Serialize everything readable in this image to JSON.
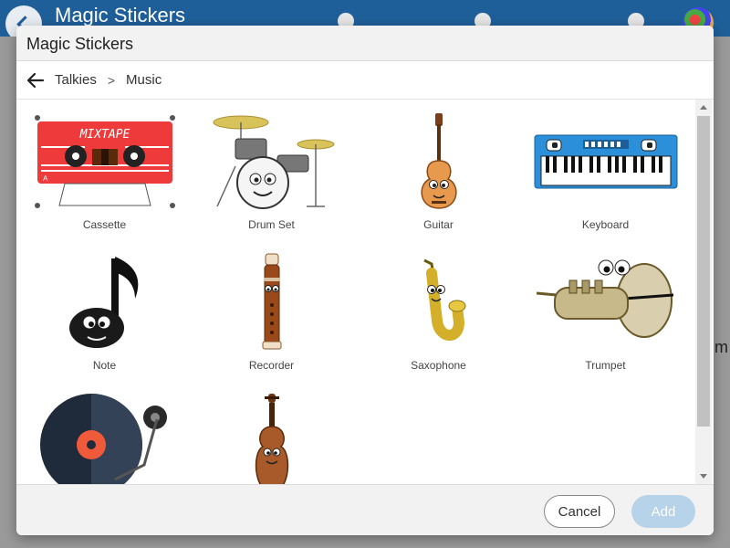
{
  "app": {
    "title": "Magic Stickers"
  },
  "modal": {
    "title": "Magic Stickers",
    "breadcrumb": [
      "Talkies",
      "Music"
    ],
    "breadcrumb_separator": ">"
  },
  "stickers": [
    {
      "label": "Cassette",
      "icon": "cassette-icon"
    },
    {
      "label": "Drum Set",
      "icon": "drum-set-icon"
    },
    {
      "label": "Guitar",
      "icon": "guitar-icon"
    },
    {
      "label": "Keyboard",
      "icon": "keyboard-icon"
    },
    {
      "label": "Note",
      "icon": "music-note-icon"
    },
    {
      "label": "Recorder",
      "icon": "recorder-icon"
    },
    {
      "label": "Saxophone",
      "icon": "saxophone-icon"
    },
    {
      "label": "Trumpet",
      "icon": "trumpet-icon"
    },
    {
      "label": "",
      "icon": "turntable-icon"
    },
    {
      "label": "",
      "icon": "violin-icon"
    }
  ],
  "cassette_text": "MIXTAPE",
  "cassette_side": "A",
  "footer": {
    "cancel_label": "Cancel",
    "add_label": "Add"
  },
  "colors": {
    "header": "#1f5f99",
    "add_button_disabled": "#b7d3ea"
  }
}
